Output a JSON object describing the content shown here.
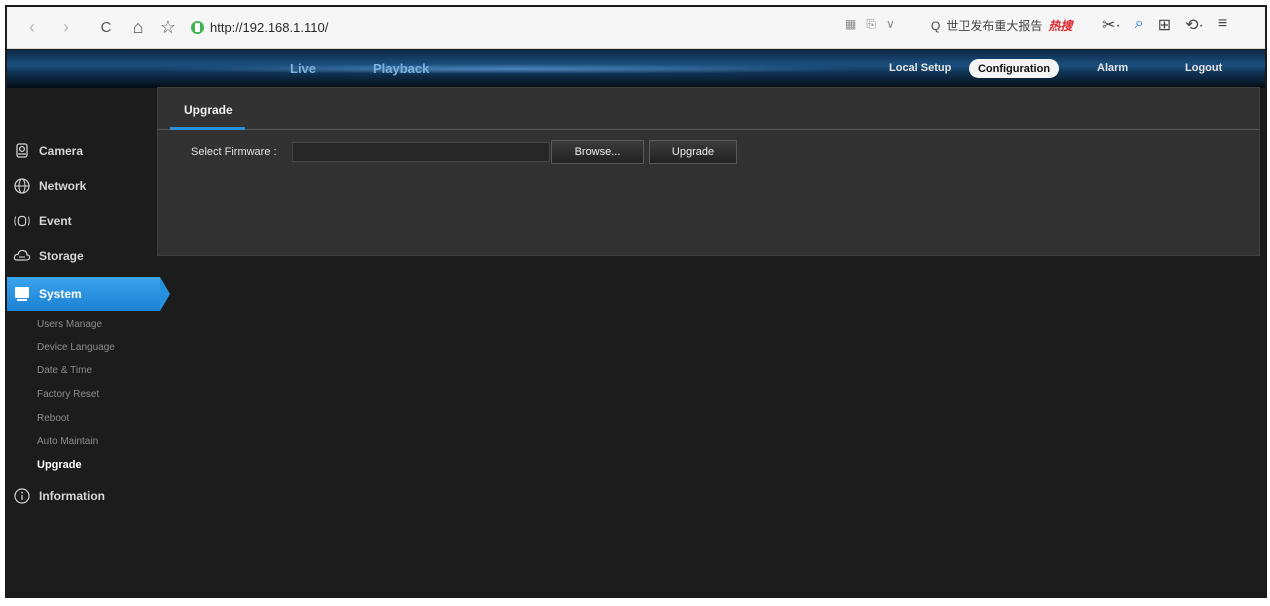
{
  "browser": {
    "back_glyph": "‹",
    "forward_glyph": "›",
    "reload_glyph": "C",
    "home_glyph": "⌂",
    "favorite_glyph": "☆",
    "url": "http://192.168.1.110/",
    "addr_tool_1": "▦",
    "addr_tool_2": "⎘",
    "addr_tool_3": "∨",
    "search_glyph": "Q",
    "search_text": "世卫发布重大报告",
    "hot_label": "热搜",
    "cut_glyph": "✂·",
    "find_glyph": "⌕",
    "grid_glyph": "⊞",
    "undo_glyph": "⟲·",
    "menu_glyph": "≡"
  },
  "header": {
    "live": "Live",
    "playback": "Playback",
    "local_setup": "Local Setup",
    "configuration": "Configuration",
    "alarm": "Alarm",
    "logout": "Logout"
  },
  "sidebar": {
    "items": [
      {
        "label": "Camera",
        "icon": "camera-icon"
      },
      {
        "label": "Network",
        "icon": "network-icon"
      },
      {
        "label": "Event",
        "icon": "event-icon"
      },
      {
        "label": "Storage",
        "icon": "storage-icon"
      },
      {
        "label": "System",
        "icon": "system-icon"
      },
      {
        "label": "Information",
        "icon": "info-icon"
      }
    ],
    "system_sub": [
      "Users Manage",
      "Device Language",
      "Date & Time",
      "Factory Reset",
      "Reboot",
      "Auto Maintain",
      "Upgrade"
    ]
  },
  "panel": {
    "tab": "Upgrade",
    "select_firmware_label": "Select Firmware :",
    "firmware_value": "",
    "browse": "Browse...",
    "upgrade": "Upgrade"
  },
  "colors": {
    "accent": "#2b8fdb",
    "background": "#1c1c1c",
    "panel": "#323232"
  }
}
